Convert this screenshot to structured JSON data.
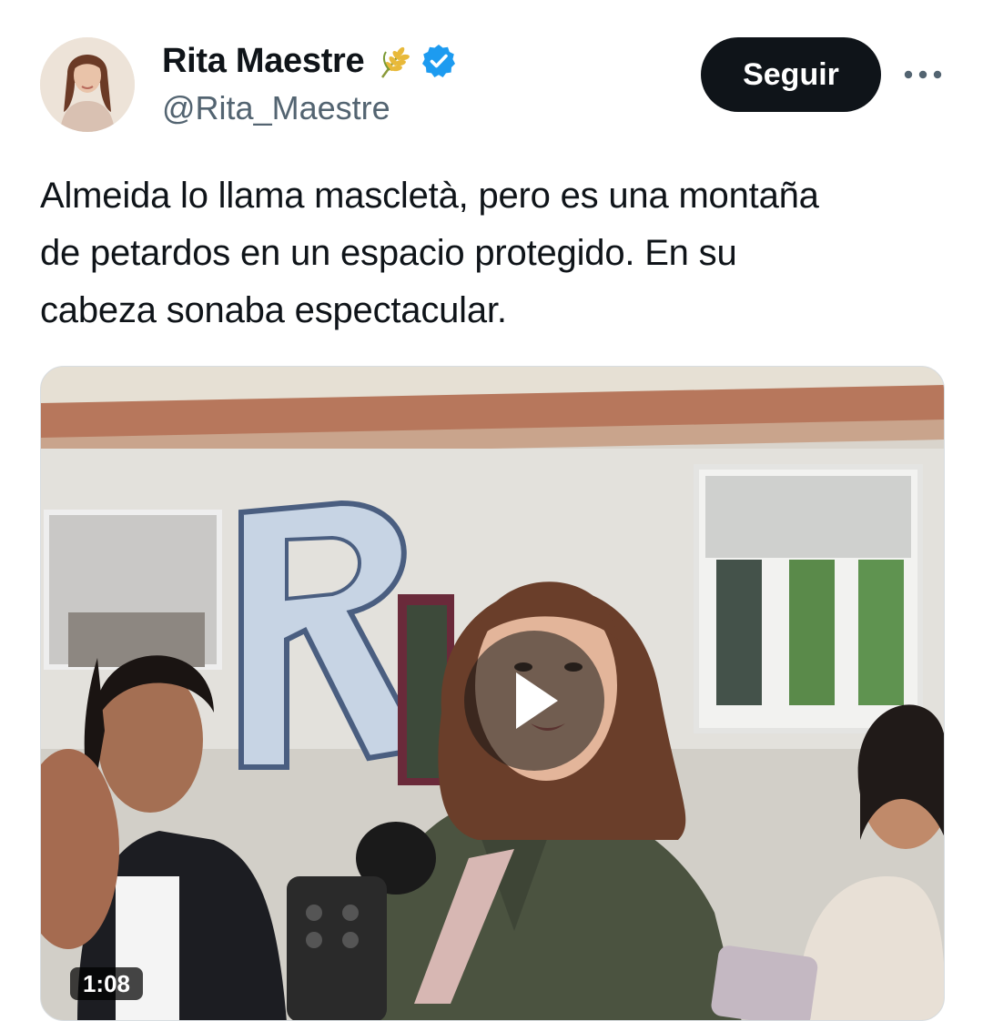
{
  "author": {
    "display_name": "Rita Maestre",
    "handle": "@Rita_Maestre",
    "avatar_icon": "profile-photo",
    "badge_icons": [
      "wheat-emoji-icon",
      "verified-badge-icon"
    ],
    "verified_color": "#1d9bf0"
  },
  "actions": {
    "follow_label": "Seguir",
    "more_icon": "more-dots-icon"
  },
  "tweet": {
    "lines": [
      "Almeida lo llama mascletà, pero es una montaña",
      "de petardos en un espacio protegido. En su",
      "cabeza sonaba espectacular."
    ]
  },
  "media": {
    "type": "video",
    "play_icon": "play-icon",
    "duration": "1:08"
  },
  "colors": {
    "text_primary": "#0f1419",
    "text_secondary": "#536471",
    "follow_button_bg": "#0f1419",
    "follow_button_text": "#ffffff"
  }
}
